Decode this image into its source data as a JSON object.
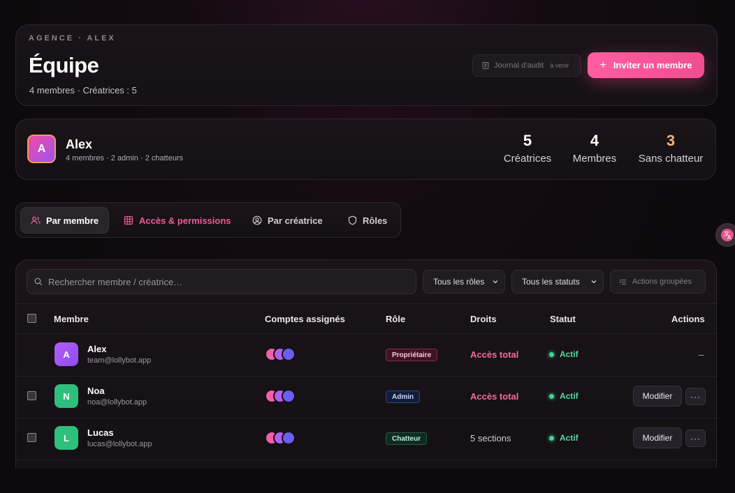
{
  "header": {
    "kicker": "AGENCE · ALEX",
    "title": "Équipe",
    "subtitle": "4 membres · Créatrices : 5",
    "audit_label": "Journal d'audit",
    "audit_badge": "à venir",
    "invite_label": "Inviter un membre"
  },
  "agency": {
    "initial": "A",
    "name": "Alex",
    "meta": "4 membres · 2 admin · 2 chatteurs",
    "stats": [
      {
        "value": "5",
        "label": "Créatrices"
      },
      {
        "value": "4",
        "label": "Membres"
      },
      {
        "value": "3",
        "label": "Sans chatteur"
      }
    ]
  },
  "tabs": [
    {
      "label": "Par membre"
    },
    {
      "label": "Accès & permissions"
    },
    {
      "label": "Par créatrice"
    },
    {
      "label": "Rôles"
    }
  ],
  "toolbar": {
    "search_placeholder": "Rechercher membre / créatrice…",
    "roles_filter": "Tous les rôles",
    "status_filter": "Tous les statuts",
    "bulk_label": "Actions groupées"
  },
  "table": {
    "columns": [
      "Membre",
      "Comptes assignés",
      "Rôle",
      "Droits",
      "Statut",
      "Actions"
    ],
    "rows": [
      {
        "initial": "A",
        "name": "Alex",
        "email": "team@lollybot.app",
        "role": "Propriétaire",
        "rights": "Accès total",
        "status": "Actif",
        "action": "–"
      },
      {
        "initial": "N",
        "name": "Noa",
        "email": "noa@lollybot.app",
        "role": "Admin",
        "rights": "Accès total",
        "status": "Actif",
        "edit": "Modifier",
        "more": "···"
      },
      {
        "initial": "L",
        "name": "Lucas",
        "email": "lucas@lollybot.app",
        "role": "Chatteur",
        "rights": "5 sections",
        "status": "Actif",
        "edit": "Modifier",
        "more": "···"
      }
    ]
  },
  "colors": {
    "accent_pink": "#f04d8f",
    "status_green": "#3dd693",
    "warn_orange": "#f5b27a"
  }
}
